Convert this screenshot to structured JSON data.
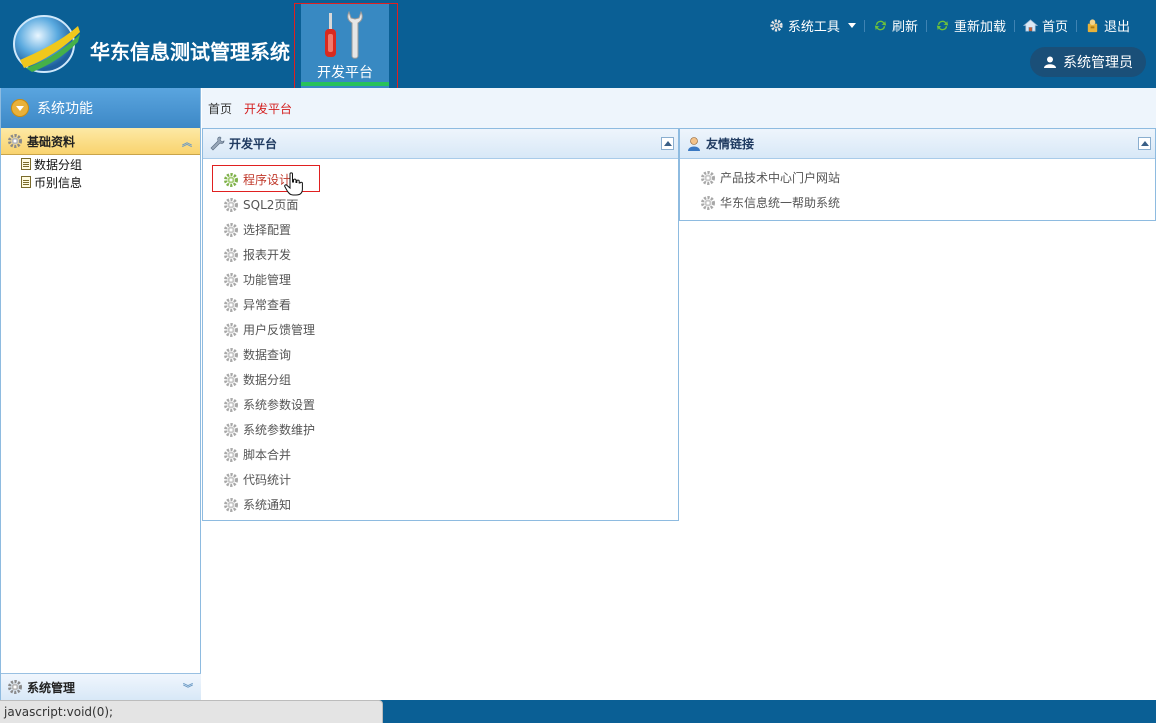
{
  "header": {
    "app_title": "华东信息测试管理系统",
    "nav_tab_label": "开发平台",
    "toolbar": [
      {
        "label": "系统工具",
        "icon": "gear-icon"
      },
      {
        "label": "刷新",
        "icon": "refresh-icon"
      },
      {
        "label": "重新加载",
        "icon": "reload-icon"
      },
      {
        "label": "首页",
        "icon": "home-icon"
      },
      {
        "label": "退出",
        "icon": "exit-icon"
      }
    ],
    "user_name": "系统管理员"
  },
  "sidebar": {
    "title": "系统功能",
    "sections": [
      {
        "title": "基础资料",
        "items": [
          "数据分组",
          "币别信息"
        ]
      },
      {
        "title": "系统管理"
      }
    ]
  },
  "breadcrumb": {
    "home": "首页",
    "current": "开发平台"
  },
  "dev_panel": {
    "title": "开发平台",
    "items": [
      "程序设计",
      "SQL2页面",
      "选择配置",
      "报表开发",
      "功能管理",
      "异常查看",
      "用户反馈管理",
      "数据查询",
      "数据分组",
      "系统参数设置",
      "系统参数维护",
      "脚本合并",
      "代码统计",
      "系统通知"
    ],
    "highlighted_color": "#c0392b"
  },
  "links_panel": {
    "title": "友情链接",
    "items": [
      "产品技术中心门户网站",
      "华东信息统一帮助系统"
    ]
  },
  "status_bar": {
    "text": "javascript:void(0);"
  },
  "colors": {
    "header_bg": "#0a5f95",
    "accent_green": "#27c15a"
  }
}
